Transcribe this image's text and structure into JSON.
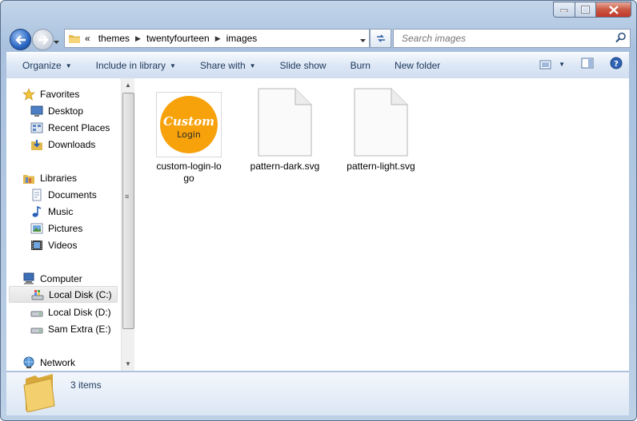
{
  "address": {
    "overflow": "«",
    "crumbs": [
      "themes",
      "twentyfourteen",
      "images"
    ]
  },
  "search": {
    "placeholder": "Search images"
  },
  "toolbar": {
    "organize": "Organize",
    "include_in_library": "Include in library",
    "share_with": "Share with",
    "slide_show": "Slide show",
    "burn": "Burn",
    "new_folder": "New folder"
  },
  "nav": {
    "favorites": {
      "label": "Favorites",
      "items": [
        "Desktop",
        "Recent Places",
        "Downloads"
      ]
    },
    "libraries": {
      "label": "Libraries",
      "items": [
        "Documents",
        "Music",
        "Pictures",
        "Videos"
      ]
    },
    "computer": {
      "label": "Computer",
      "items": [
        "Local Disk (C:)",
        "Local Disk (D:)",
        "Sam Extra (E:)"
      ]
    },
    "network": {
      "label": "Network"
    }
  },
  "files": [
    {
      "name": "custom-login-logo",
      "display": "custom-login-lo\ngo",
      "type": "logo",
      "logo_top": "Custom",
      "logo_bottom": "Login"
    },
    {
      "name": "pattern-dark.svg",
      "display": "pattern-dark.svg",
      "type": "svg"
    },
    {
      "name": "pattern-light.svg",
      "display": "pattern-light.svg",
      "type": "svg"
    }
  ],
  "status": {
    "count": "3 items"
  },
  "colors": {
    "logo_orange": "#f7a20b",
    "accent": "#1e395b"
  }
}
